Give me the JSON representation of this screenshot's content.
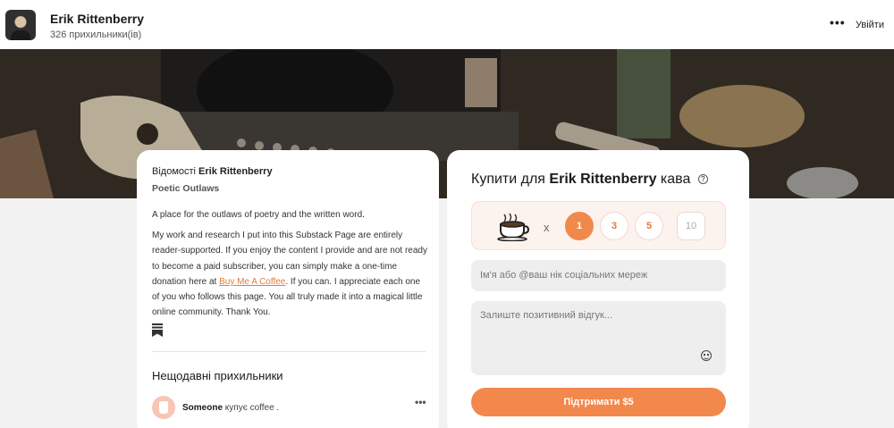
{
  "header": {
    "name": "Erik Rittenberry",
    "followers": "326 прихильники(ів)",
    "more": "•••",
    "login": "Увійти"
  },
  "about": {
    "prefix": "Відомості",
    "name": "Erik Rittenberry",
    "publication": "Poetic Outlaws",
    "desc1": "A place for the outlaws of poetry and the written word.",
    "desc2_before": "My work and research I put into this Substack Page are entirely reader-supported. If you enjoy the content I provide and are not ready to become a paid subscriber, you can simply make a one-time donation here at ",
    "desc2_link": "Buy Me A Coffee",
    "desc2_after": ". If you can. I appreciate each one of you who follows this page. You all truly made it into a magical little online community. Thank You."
  },
  "recent": {
    "heading": "Нещодавні прихильники",
    "supporter_name": "Someone",
    "supporter_text": "купує coffee .",
    "more": "•••"
  },
  "buy": {
    "prefix": "Купити для",
    "name": "Erik Rittenberry",
    "suffix": "кава",
    "help": "?",
    "times": "x",
    "quantities": [
      "1",
      "3",
      "5"
    ],
    "selected_quantity": "1",
    "custom_quantity": "10",
    "name_placeholder": "Ім'я або @ваш нік соціальних мереж",
    "message_placeholder": "Залиште позитивний відгук...",
    "button": "Підтримати $5"
  },
  "colors": {
    "accent": "#f3884c",
    "link": "#e37d3b"
  }
}
